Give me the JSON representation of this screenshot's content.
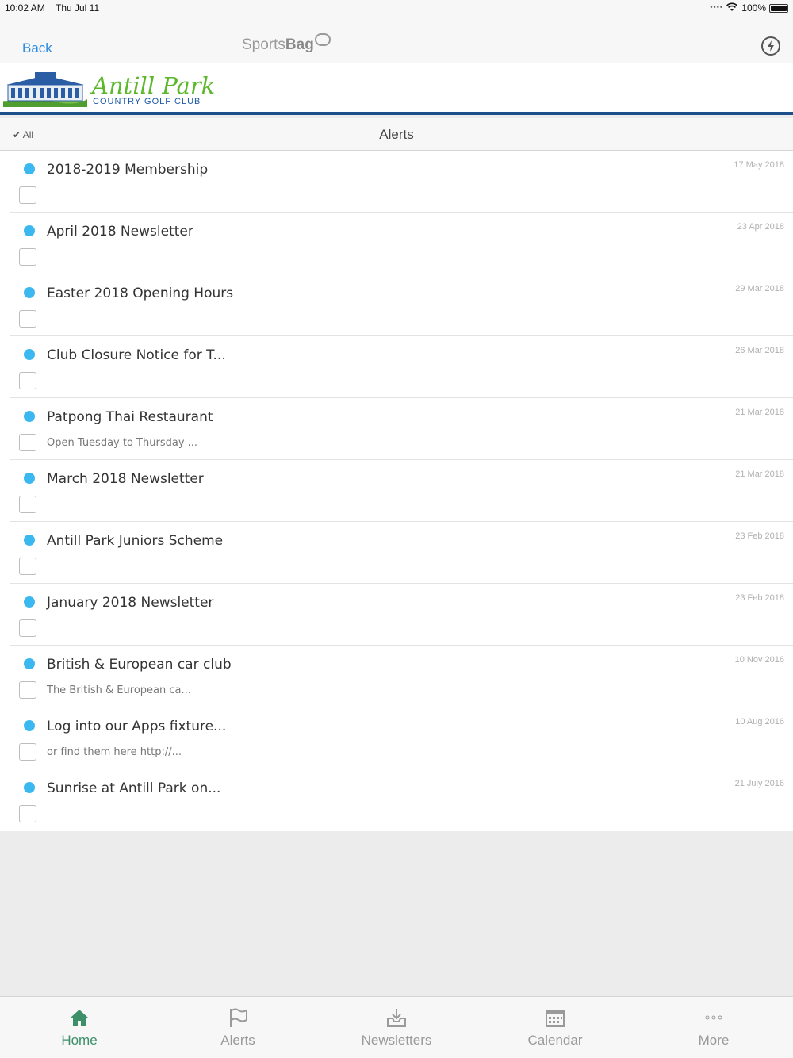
{
  "status_bar": {
    "time": "10:02 AM",
    "date": "Thu Jul 11",
    "battery": "100%"
  },
  "nav": {
    "back_label": "Back",
    "brand_light": "Sports",
    "brand_bold": "Bag",
    "sync_icon": "sync-icon"
  },
  "club": {
    "name": "Antill Park",
    "subtitle": "COUNTRY GOLF CLUB"
  },
  "filter": {
    "all_label": "All",
    "title": "Alerts"
  },
  "alerts": [
    {
      "title": "2018-2019 Membership",
      "subtitle": "",
      "date": "17 May 2018"
    },
    {
      "title": "April 2018 Newsletter",
      "subtitle": "",
      "date": "23 Apr 2018"
    },
    {
      "title": "Easter 2018 Opening Hours",
      "subtitle": "",
      "date": "29 Mar 2018"
    },
    {
      "title": "Club Closure Notice for T...",
      "subtitle": "",
      "date": "26 Mar 2018"
    },
    {
      "title": "Patpong Thai Restaurant",
      "subtitle": "Open Tuesday to Thursday ...",
      "date": "21 Mar 2018"
    },
    {
      "title": "March 2018 Newsletter",
      "subtitle": "",
      "date": "21 Mar 2018"
    },
    {
      "title": "Antill Park Juniors Scheme",
      "subtitle": "",
      "date": "23 Feb 2018"
    },
    {
      "title": "January 2018 Newsletter",
      "subtitle": "",
      "date": "23 Feb 2018"
    },
    {
      "title": "British & European car club",
      "subtitle": "The British & European ca...",
      "date": "10 Nov 2016"
    },
    {
      "title": "Log into our Apps fixture...",
      "subtitle": "or find them here http://...",
      "date": "10 Aug 2016"
    },
    {
      "title": "Sunrise at Antill Park on...",
      "subtitle": "",
      "date": "21 July 2016"
    }
  ],
  "tabs": [
    {
      "label": "Home",
      "icon": "home-icon",
      "active": true
    },
    {
      "label": "Alerts",
      "icon": "flag-icon",
      "active": false
    },
    {
      "label": "Newsletters",
      "icon": "inbox-download-icon",
      "active": false
    },
    {
      "label": "Calendar",
      "icon": "calendar-icon",
      "active": false
    },
    {
      "label": "More",
      "icon": "more-dots-icon",
      "active": false
    }
  ],
  "colors": {
    "unread_dot": "#3cb8f0",
    "link": "#2f8be0",
    "header_rule": "#1d4f8a",
    "active_tab": "#3d8f6a",
    "club_green": "#5ab82a",
    "club_blue": "#1d5aa8"
  }
}
